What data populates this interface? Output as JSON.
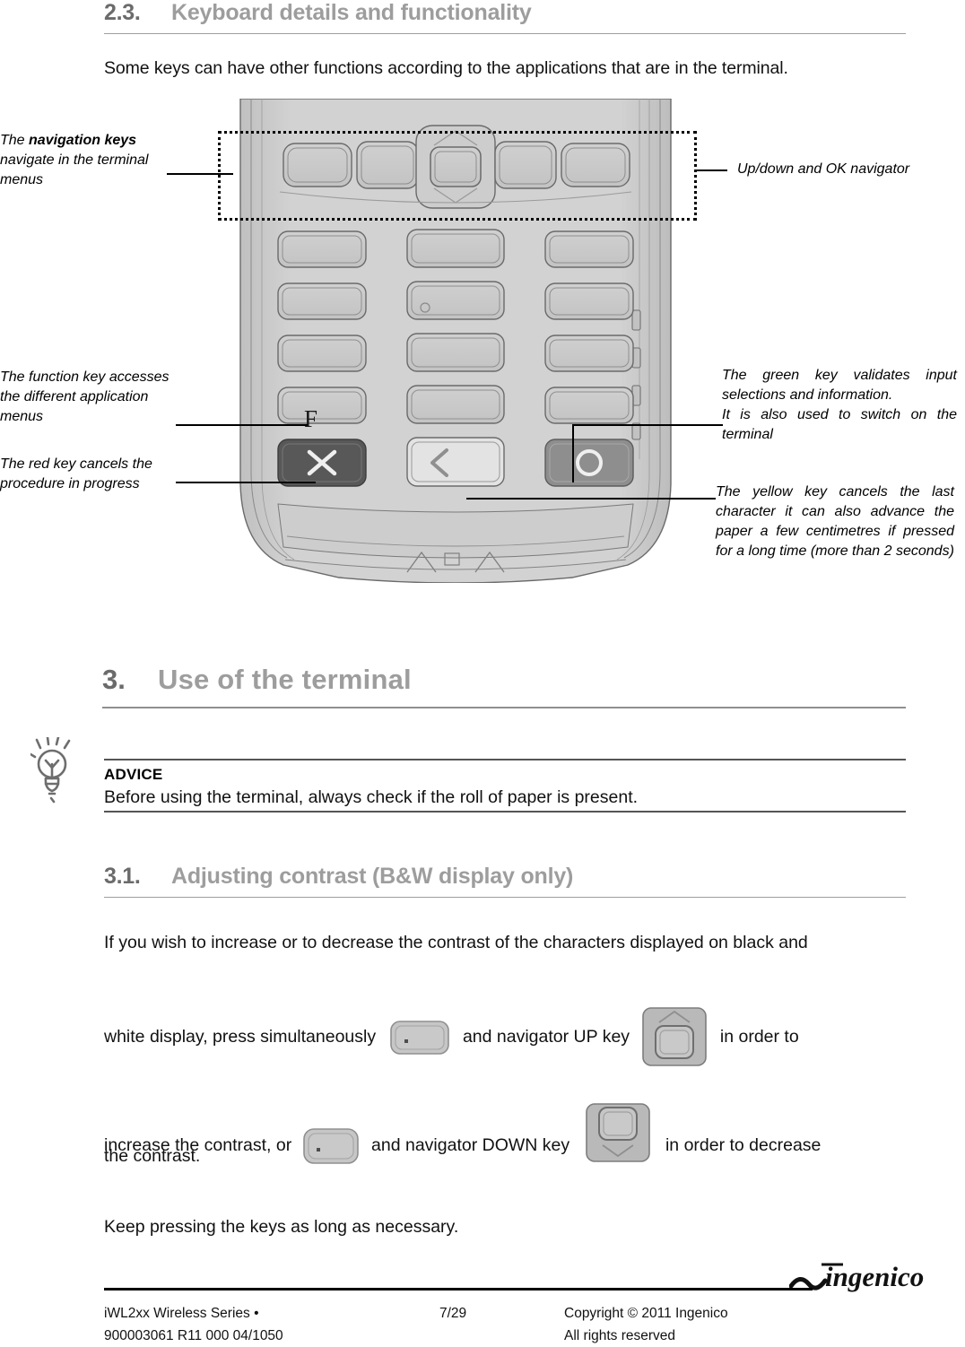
{
  "section_2_3": {
    "number": "2.3.",
    "title": "Keyboard details and functionality",
    "intro": "Some keys can have other functions according to the applications that are in the terminal."
  },
  "diagram": {
    "callouts": {
      "navigation_keys": {
        "prefix": "The ",
        "bold": "navigation keys",
        "suffix": " navigate in the terminal menus"
      },
      "function_key": "The function key accesses the different application menus",
      "red_key": "The red key cancels the procedure in progress",
      "navigator": "Up/down and OK navigator",
      "green_key": "The green key validates input selections and information.\nIt is also used to switch on the terminal",
      "yellow_key": "The yellow key cancels the last character it can also advance the paper a few centimetres if pressed for a long time (more than 2 seconds)"
    },
    "keys": {
      "function_label": "F",
      "cancel_icon": "x-cross-icon",
      "correct_icon": "back-chevron-icon",
      "validate_icon": "circle-icon",
      "up_icon": "chevron-up-icon",
      "down_icon": "chevron-down-icon"
    },
    "colors": {
      "body": "#cfcfcf",
      "key_face": "#c8c8c8",
      "red_key": "#4f4f4f",
      "yellow_key": "#dcdcdc",
      "green_key": "#8c8c8c",
      "outline": "#5a5a5a"
    }
  },
  "section_3": {
    "number": "3.",
    "title": "Use of the terminal"
  },
  "advice": {
    "icon": "lightbulb-icon",
    "title": "ADVICE",
    "text": "Before using the terminal, always check if the roll of paper is present."
  },
  "section_3_1": {
    "number": "3.1.",
    "title": "Adjusting contrast (B&W display only)",
    "paragraph_parts": {
      "line1": "If you wish to increase or to decrease the contrast of the characters displayed on black and",
      "line2a": "white  display,  press  simultaneously",
      "line2b": "and navigator  UP  key",
      "line2c": "in  order  to",
      "line3a": "increase the contrast, or",
      "line3b": "and  navigator DOWN key",
      "line3c": "in order to decrease",
      "line4": "the contrast.",
      "line5": "Keep pressing the keys as long as necessary."
    },
    "inline_icons": {
      "dot_key": "dot-key-icon",
      "nav_up_key": "navigator-up-key-icon",
      "nav_down_key": "navigator-down-key-icon"
    }
  },
  "footer": {
    "left_line1": "iWL2xx Wireless Series  •",
    "left_line2": "900003061 R11 000 04/1050",
    "page": "7/29",
    "right_line1": "Copyright © 2011 Ingenico",
    "right_line2": "All rights reserved",
    "logo_text": "ingenico"
  }
}
